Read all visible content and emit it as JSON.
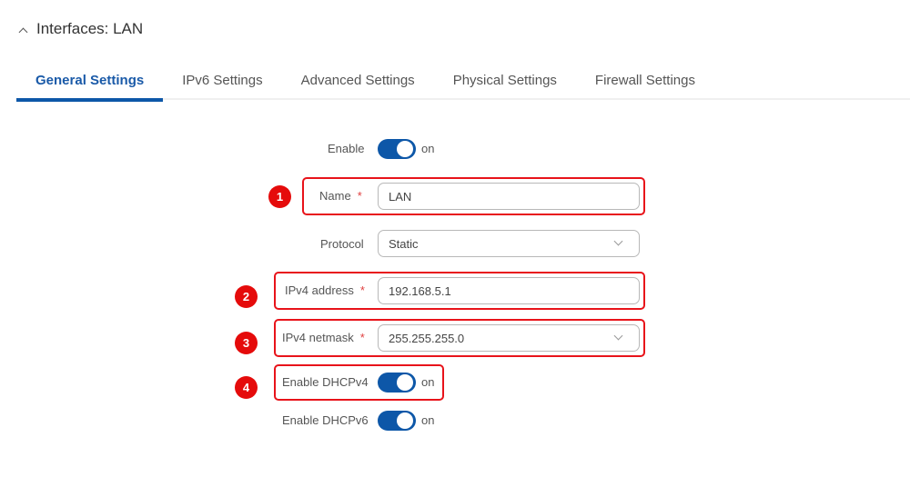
{
  "header": {
    "title": "Interfaces: LAN",
    "collapse_icon": "chevron-up-icon"
  },
  "tabs": [
    {
      "label": "General Settings",
      "active": true
    },
    {
      "label": "IPv6 Settings",
      "active": false
    },
    {
      "label": "Advanced Settings",
      "active": false
    },
    {
      "label": "Physical Settings",
      "active": false
    },
    {
      "label": "Firewall Settings",
      "active": false
    }
  ],
  "form": {
    "enable": {
      "label": "Enable",
      "state": "on"
    },
    "name": {
      "label": "Name",
      "required_mark": "*",
      "value": "LAN"
    },
    "protocol": {
      "label": "Protocol",
      "value": "Static"
    },
    "ipv4_address": {
      "label": "IPv4 address",
      "required_mark": "*",
      "value": "192.168.5.1"
    },
    "ipv4_netmask": {
      "label": "IPv4 netmask",
      "required_mark": "*",
      "value": "255.255.255.0"
    },
    "enable_dhcpv4": {
      "label": "Enable DHCPv4",
      "state": "on"
    },
    "enable_dhcpv6": {
      "label": "Enable DHCPv6",
      "state": "on"
    }
  },
  "annotations": [
    {
      "number": "1",
      "target": "name"
    },
    {
      "number": "2",
      "target": "ipv4_address"
    },
    {
      "number": "3",
      "target": "ipv4_netmask"
    },
    {
      "number": "4",
      "target": "enable_dhcpv4"
    }
  ],
  "colors": {
    "accent": "#0d57a8",
    "highlight": "#e8131a",
    "badge": "#e50b0b",
    "required": "#e04040"
  }
}
